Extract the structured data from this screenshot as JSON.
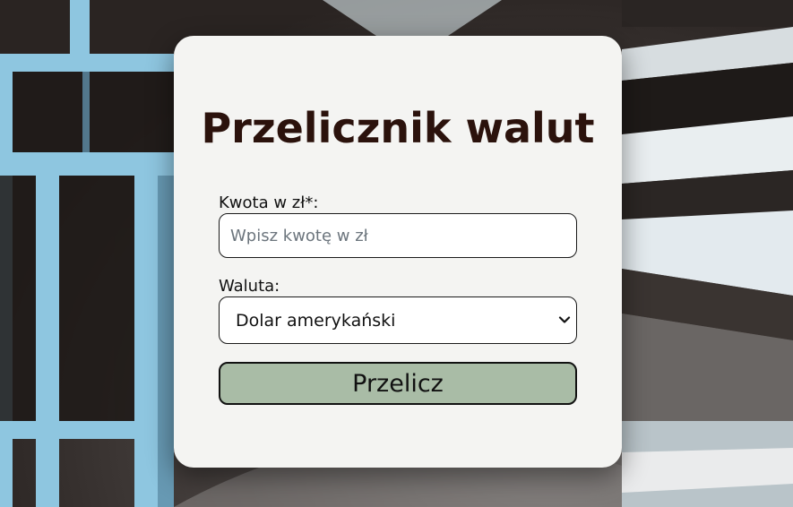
{
  "form": {
    "title": "Przelicznik walut",
    "amount_label": "Kwota w zł*:",
    "amount_placeholder": "Wpisz kwotę w zł",
    "amount_value": "",
    "currency_label": "Waluta:",
    "currency_selected": "Dolar amerykański",
    "submit_label": "Przelicz"
  },
  "colors": {
    "card_background": "#f4f4f2",
    "title": "#2b120c",
    "button_background": "#a9bca6",
    "background_accent": "#8ec6e0"
  },
  "icons": {
    "select_chevron": "chevron-down-icon"
  }
}
